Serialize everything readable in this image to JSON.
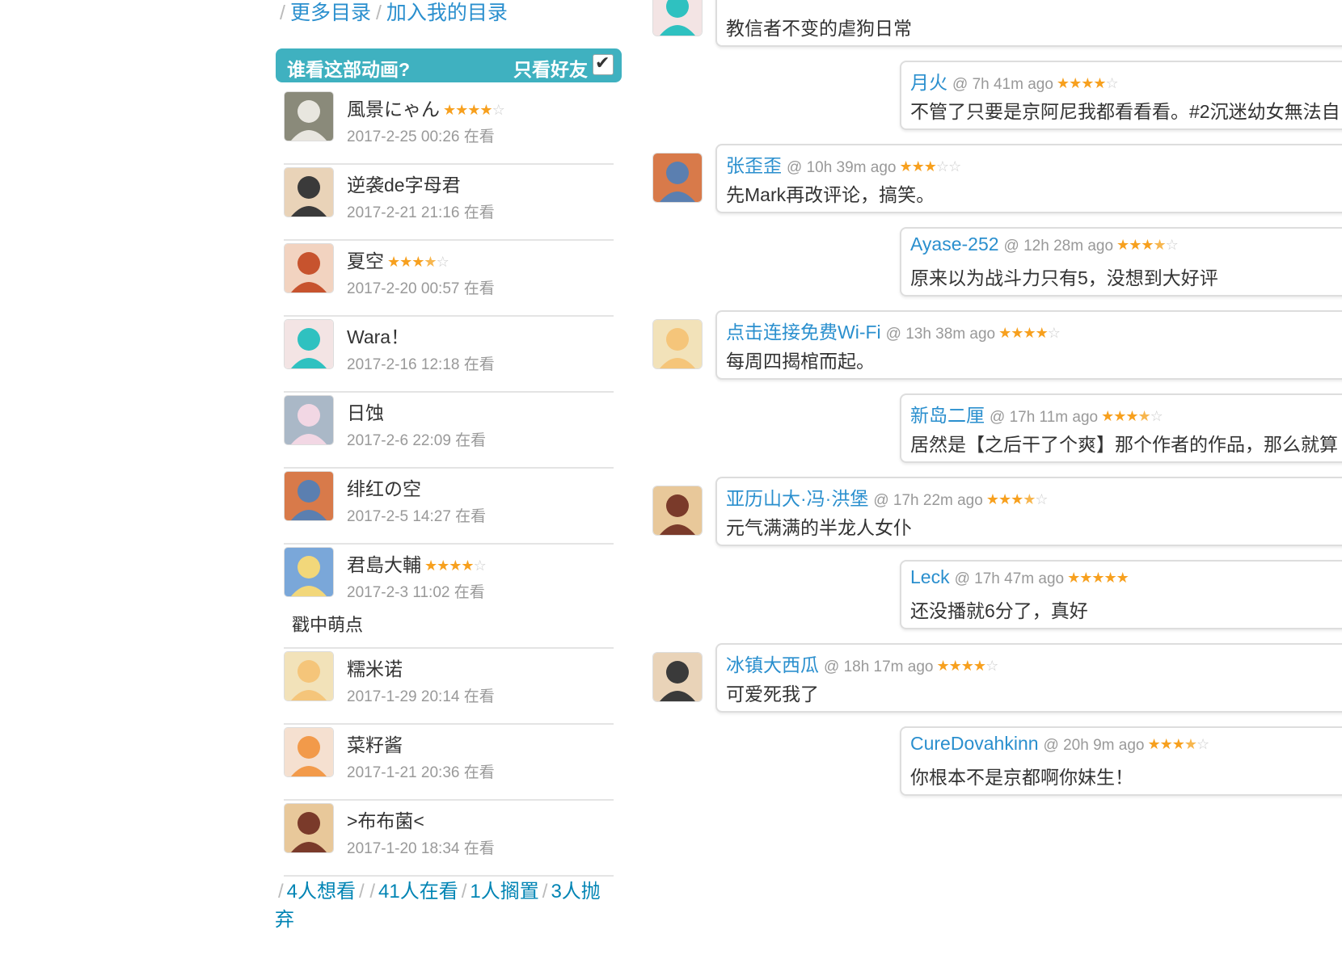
{
  "top_links": {
    "more": "更多目录",
    "add": "加入我的目录"
  },
  "who_header": {
    "title": "谁看这部动画?",
    "friends_only": "只看好友"
  },
  "watchers": [
    {
      "name": "風景にゃん",
      "time": "2017-2-25 00:26 在看",
      "rating": 4
    },
    {
      "name": "逆袭de字母君",
      "time": "2017-2-21 21:16 在看",
      "rating": null
    },
    {
      "name": "夏空",
      "time": "2017-2-20 00:57 在看",
      "rating": 3.5
    },
    {
      "name": "Wara！",
      "time": "2017-2-16 12:18 在看",
      "rating": null
    },
    {
      "name": "日蚀",
      "time": "2017-2-6 22:09 在看",
      "rating": null
    },
    {
      "name": "绯红の空",
      "time": "2017-2-5 14:27 在看",
      "rating": null
    },
    {
      "name": "君島大輔",
      "time": "2017-2-3 11:02 在看",
      "rating": 4,
      "note": "戳中萌点"
    },
    {
      "name": "糯米诺",
      "time": "2017-1-29 20:14 在看",
      "rating": null
    },
    {
      "name": "菜籽酱",
      "time": "2017-1-21 20:36 在看",
      "rating": null
    },
    {
      "name": ">布布菌<",
      "time": "2017-1-20 18:34 在看",
      "rating": null
    }
  ],
  "status_links": {
    "wish": "4人想看",
    "watching": "41人在看",
    "onhold": "1人搁置",
    "dropped": "3人抛弃"
  },
  "comments": [
    {
      "user": "",
      "ago": "",
      "rating": null,
      "text": "教信者不变的虐狗日常",
      "side": "left"
    },
    {
      "user": "月火",
      "ago": "@ 7h 41m ago",
      "rating": 4,
      "text": "不管了只要是京阿尼我都看看看。#2沉迷幼女無法自",
      "side": "right"
    },
    {
      "user": "张歪歪",
      "ago": "@ 10h 39m ago",
      "rating": 3,
      "text": "先Mark再改评论，搞笑。",
      "side": "left"
    },
    {
      "user": "Ayase-252",
      "ago": "@ 12h 28m ago",
      "rating": 3.5,
      "text": "原来以为战斗力只有5，没想到大好评",
      "side": "right"
    },
    {
      "user": "点击连接免费Wi-Fi",
      "ago": "@ 13h 38m ago",
      "rating": 4,
      "text": "每周四揭棺而起。",
      "side": "left"
    },
    {
      "user": "新岛二厘",
      "ago": "@ 17h 11m ago",
      "rating": 3.5,
      "text": "居然是【之后干了个爽】那个作者的作品，那么就算",
      "side": "right"
    },
    {
      "user": "亚历山大·冯·洪堡",
      "ago": "@ 17h 22m ago",
      "rating": 3.5,
      "text": "元气满满的半龙人女仆",
      "side": "left"
    },
    {
      "user": "Leck",
      "ago": "@ 17h 47m ago",
      "rating": 5,
      "text": "还没播就6分了，真好",
      "side": "right"
    },
    {
      "user": "冰镇大西瓜",
      "ago": "@ 18h 17m ago",
      "rating": 4,
      "text": "可爱死我了",
      "side": "left"
    },
    {
      "user": "CureDovahkinn",
      "ago": "@ 20h 9m ago",
      "rating": 3.5,
      "text": "你根本不是京都啊你妹生！",
      "side": "right"
    }
  ],
  "colors": {
    "accent": "#3fb1c0",
    "link": "#2a8fce",
    "star": "#f7a01e"
  }
}
